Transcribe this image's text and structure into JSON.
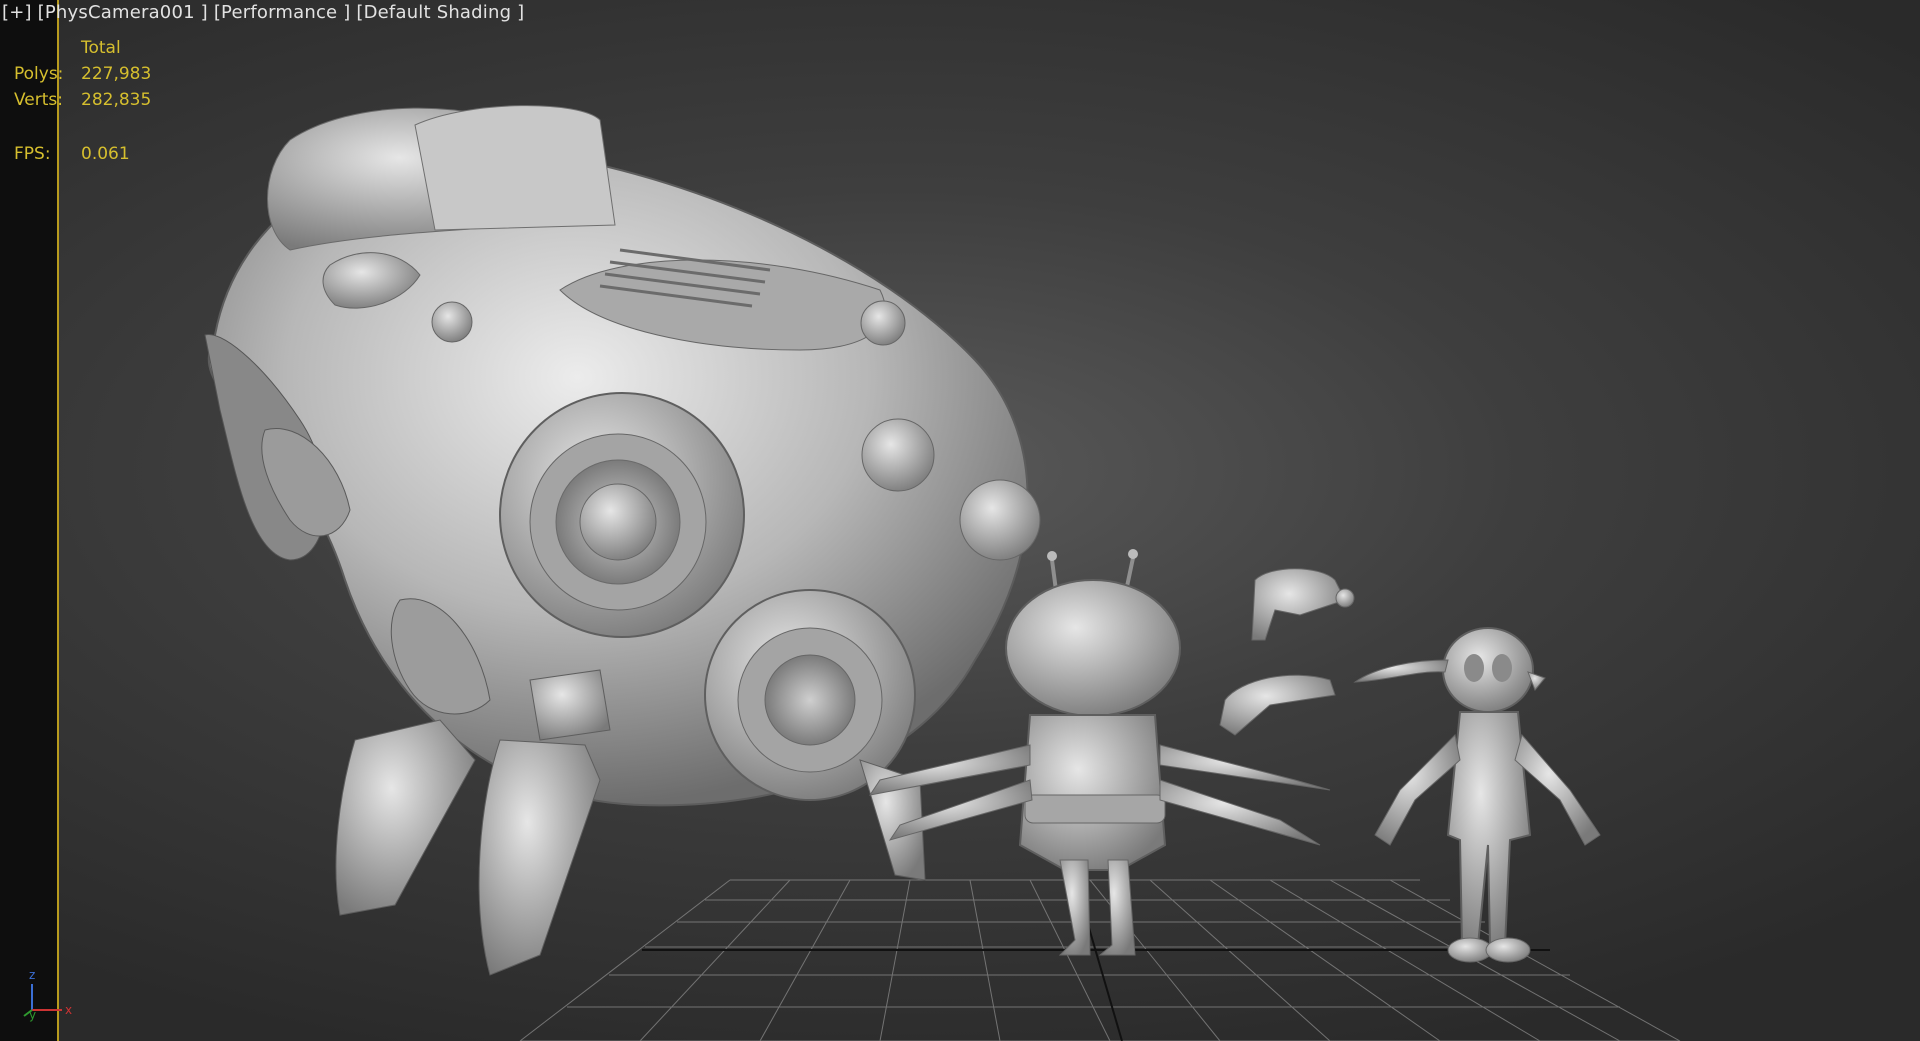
{
  "viewport": {
    "label": "[+] [PhysCamera001 ] [Performance ] [Default Shading ]"
  },
  "stats": {
    "header": "Total",
    "polys_label": "Polys:",
    "polys_value": "227,983",
    "verts_label": "Verts:",
    "verts_value": "282,835",
    "fps_label": "FPS:",
    "fps_value": "0.061"
  },
  "gizmo": {
    "z": "z",
    "y": "y",
    "x": "x"
  },
  "colors": {
    "stats_text": "#d6bf2e",
    "safe_frame": "#b89b1e",
    "label_text": "#e2e2e2",
    "model": "#bdbdbd"
  },
  "scene_objects": [
    "robot-ship-model",
    "antenna-robot-model",
    "ray-gun-model",
    "ray-pistol-model",
    "alien-character-model",
    "ground-grid"
  ]
}
